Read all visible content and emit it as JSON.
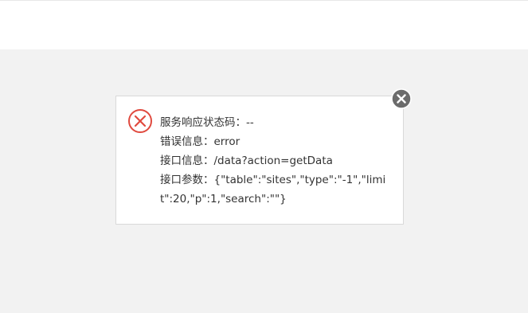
{
  "dialog": {
    "lines": [
      {
        "label": "服务响应状态码：",
        "value": "--"
      },
      {
        "label": "错误信息：",
        "value": "error"
      },
      {
        "label": "接口信息：",
        "value": "/data?action=getData"
      },
      {
        "label": "接口参数：",
        "value": "{\"table\":\"sites\",\"type\":\"-1\",\"limit\":20,\"p\":1,\"search\":\"\"}"
      }
    ],
    "icon": "error-x-circle-icon",
    "close_icon": "close-icon"
  },
  "colors": {
    "error_red": "#e04a3f",
    "close_bg": "#6b6b6b",
    "page_bg": "#f2f2f2"
  }
}
